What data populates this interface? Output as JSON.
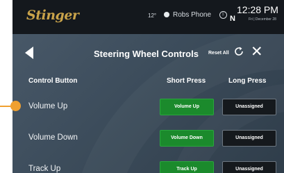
{
  "status_bar": {
    "logo": "Stinger",
    "temperature": "12°",
    "phone_name": "Robs Phone",
    "compass": "N",
    "time": "12:28 PM",
    "date": "Fri | December 28"
  },
  "header": {
    "title": "Steering Wheel Controls",
    "reset_label": "Reset All"
  },
  "columns": {
    "control": "Control Button",
    "short": "Short Press",
    "long": "Long Press"
  },
  "rows": [
    {
      "label": "Volume Up",
      "short": "Volume Up",
      "long": "Unassigned"
    },
    {
      "label": "Volume Down",
      "short": "Volume Down",
      "long": "Unassigned"
    },
    {
      "label": "Track Up",
      "short": "Track Up",
      "long": "Unassigned"
    }
  ],
  "colors": {
    "short_button": "#1b8a2c",
    "long_button": "#15191d",
    "callout": "#f0a030",
    "logo": "#c9a34a"
  }
}
